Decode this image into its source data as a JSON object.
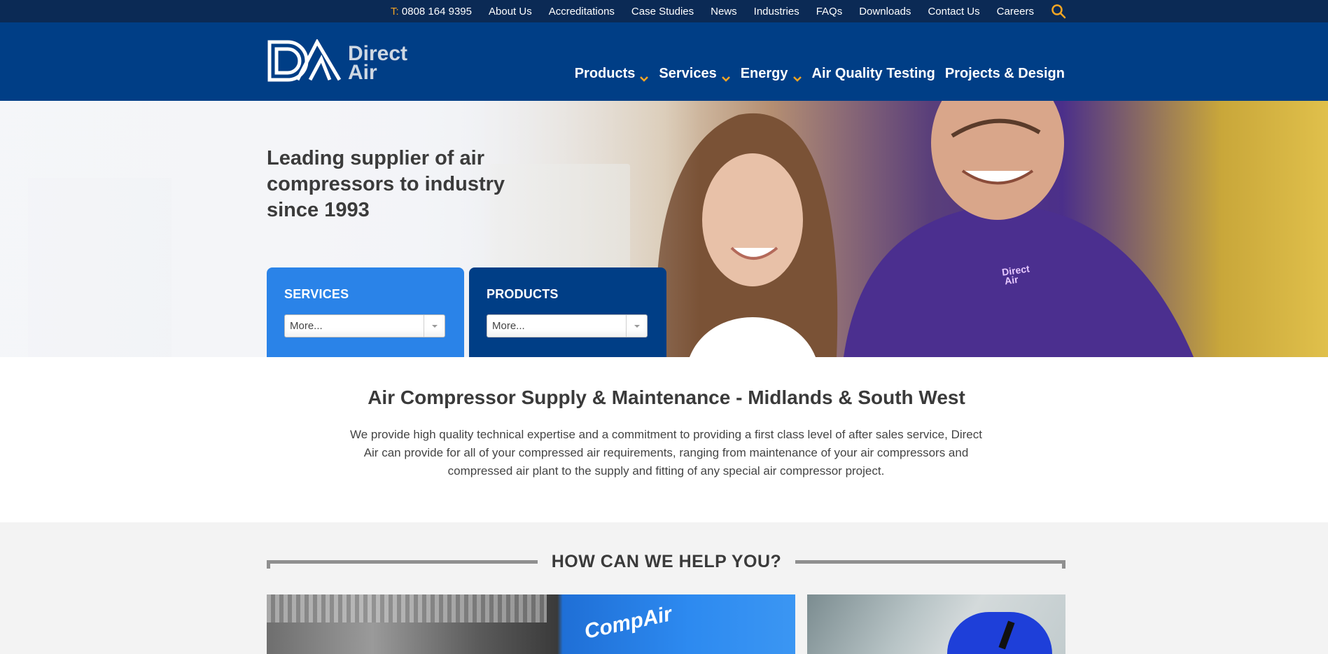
{
  "topbar": {
    "phone_prefix": "T:",
    "phone": "0808 164 9395",
    "links": [
      "About Us",
      "Accreditations",
      "Case Studies",
      "News",
      "Industries",
      "FAQs",
      "Downloads",
      "Contact Us",
      "Careers"
    ],
    "icons": {
      "search": "search-icon"
    }
  },
  "header": {
    "logo_line1": "Direct",
    "logo_line2": "Air",
    "nav": [
      {
        "label": "Products",
        "has_dropdown": true
      },
      {
        "label": "Services",
        "has_dropdown": true
      },
      {
        "label": "Energy",
        "has_dropdown": true
      },
      {
        "label": "Air Quality Testing",
        "has_dropdown": false
      },
      {
        "label": "Projects & Design",
        "has_dropdown": false
      }
    ]
  },
  "hero": {
    "title": "Leading supplier of air compressors to industry since 1993",
    "shirt_logo_line1": "Direct",
    "shirt_logo_line2": "Air",
    "services_box": {
      "title": "SERVICES",
      "selected": "More..."
    },
    "products_box": {
      "title": "PRODUCTS",
      "selected": "More..."
    }
  },
  "intro": {
    "title": "Air Compressor Supply & Maintenance - Midlands & South West",
    "text": "We provide high quality technical expertise and a commitment to providing a first class level of after sales service, Direct Air can provide for all of your compressed air requirements, ranging from maintenance of your air compressors and compressed air plant to the supply and fitting of any special air compressor project."
  },
  "help": {
    "title": "HOW CAN WE HELP YOU?",
    "card1_brand": "CompAir"
  },
  "colors": {
    "topbar_bg": "#0b2a55",
    "header_bg": "#003e86",
    "accent_orange": "#f5a623",
    "services_blue": "#2a83e8",
    "products_navy": "#003e86"
  }
}
